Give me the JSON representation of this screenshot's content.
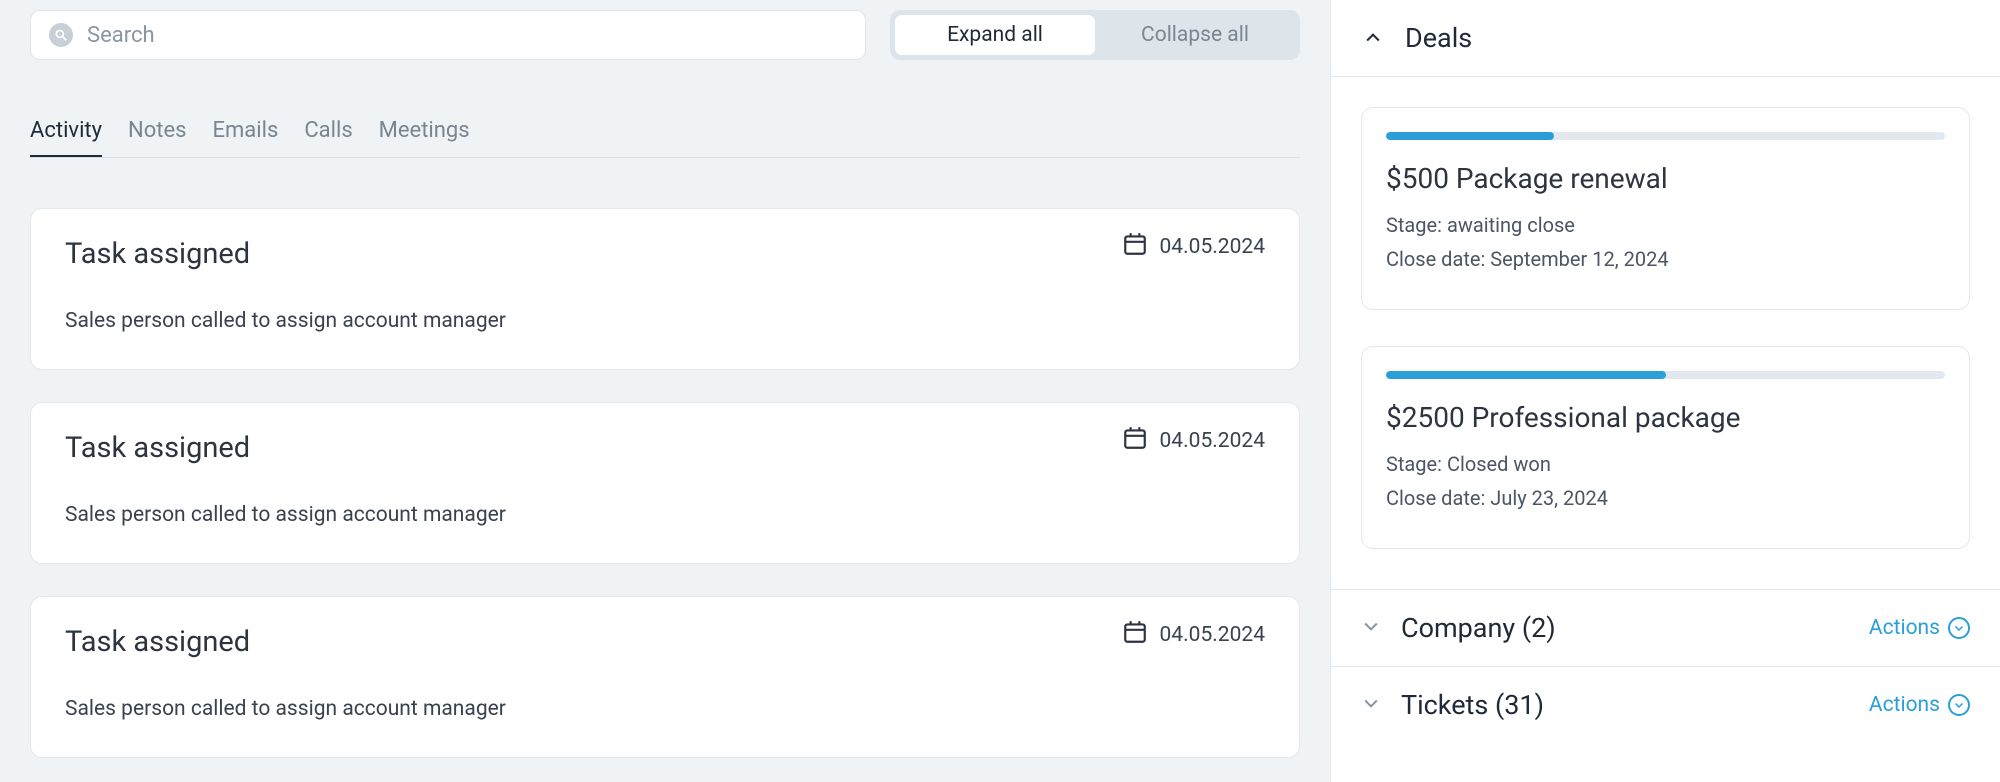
{
  "search": {
    "placeholder": "Search"
  },
  "toggle": {
    "expand": "Expand all",
    "collapse": "Collapse all"
  },
  "tabs": [
    {
      "label": "Activity",
      "active": true
    },
    {
      "label": "Notes",
      "active": false
    },
    {
      "label": "Emails",
      "active": false
    },
    {
      "label": "Calls",
      "active": false
    },
    {
      "label": "Meetings",
      "active": false
    }
  ],
  "activities": [
    {
      "title": "Task assigned",
      "date": "04.05.2024",
      "body": "Sales person called to assign account manager"
    },
    {
      "title": "Task assigned",
      "date": "04.05.2024",
      "body": "Sales person called to assign account manager"
    },
    {
      "title": "Task assigned",
      "date": "04.05.2024",
      "body": "Sales person called to assign account manager"
    }
  ],
  "sidebar": {
    "deals_title": "Deals",
    "deals": [
      {
        "title": "$500 Package renewal",
        "stage": "Stage: awaiting close",
        "close": "Close date: September 12, 2024",
        "progress": 30
      },
      {
        "title": "$2500 Professional package",
        "stage": "Stage: Closed won",
        "close": "Close date: July 23, 2024",
        "progress": 50
      }
    ],
    "company_title": "Company (2)",
    "tickets_title": "Tickets (31)",
    "actions_label": "Actions"
  }
}
